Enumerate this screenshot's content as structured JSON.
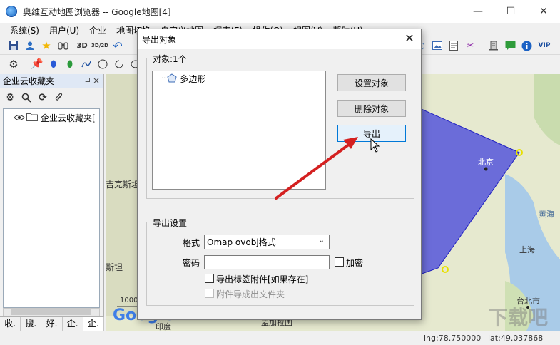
{
  "window": {
    "title": "奥维互动地图浏览器 -- Google地图[4]",
    "controls": {
      "minimize": "—",
      "maximize": "☐",
      "close": "✕"
    }
  },
  "menu": [
    "系统(S)",
    "用户(U)",
    "企业",
    "地图切换",
    "自定义地图",
    "探索(E)",
    "操作(O)",
    "视图(V)",
    "帮助(H)"
  ],
  "toolbar": {
    "items": [
      "save-icon",
      "user-icon",
      "star-icon",
      "binoculars-icon",
      "3d-icon",
      "3d2d-icon",
      "undo-icon"
    ],
    "label_3d": "3D",
    "label_3d2d": "3D/2D",
    "right_items": [
      "layers-icon",
      "image-icon",
      "note-icon",
      "scissors-icon",
      "building-icon",
      "chat-icon",
      "info-icon"
    ],
    "vip": "VIP"
  },
  "left_panel": {
    "title": "企业云收藏夹",
    "pin": "⊐",
    "close": "×",
    "tree_node": "企业云收藏夹[",
    "tabs": [
      "收.",
      "搜.",
      "好.",
      "企.",
      "企."
    ]
  },
  "map": {
    "labels": [
      "北京",
      "黄海",
      "上海",
      "台北市",
      "吉克斯坦",
      "斯坦",
      "1000",
      "印度",
      "孟加拉国"
    ],
    "logo": "Google",
    "watermark": "下载吧"
  },
  "status": {
    "lng": "lng:78.750000",
    "lat": "lat:49.037868"
  },
  "dialog": {
    "title": "导出对象",
    "close": "✕",
    "objects_group": "对象:1个",
    "list_item": "多边形",
    "btn_set": "设置对象",
    "btn_delete": "删除对象",
    "btn_export": "导出",
    "settings_group": "导出设置",
    "format_label": "格式",
    "format_value": "Omap ovobj格式",
    "password_label": "密码",
    "encrypt_label": "加密",
    "export_attach_label": "导出标签附件[如果存在]",
    "attach_folder_label": "附件导成出文件夹"
  }
}
